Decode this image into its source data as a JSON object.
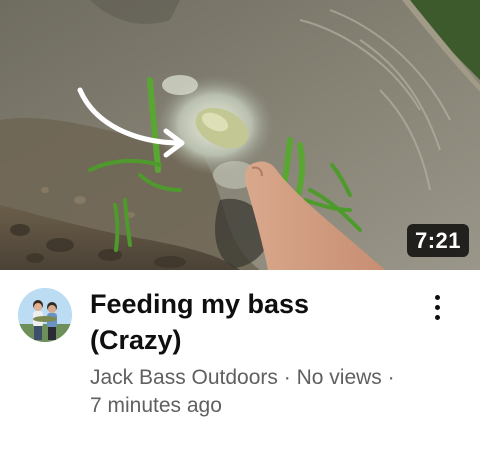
{
  "video": {
    "duration": "7:21",
    "title_line1": "Feeding my bass",
    "title_line2": "(Crazy)",
    "channel": "Jack Bass Outdoors",
    "separator": " · ",
    "views": "No views",
    "time_ago": "7 minutes ago"
  },
  "icons": {
    "more": "more-vert-icon",
    "annotation": "curved-arrow-annotation"
  },
  "colors": {
    "water": "#7d7a6d",
    "grass": "#4f9a2c",
    "duration_bg": "#000000",
    "title": "#0f0f0f",
    "meta_text": "#606060"
  }
}
